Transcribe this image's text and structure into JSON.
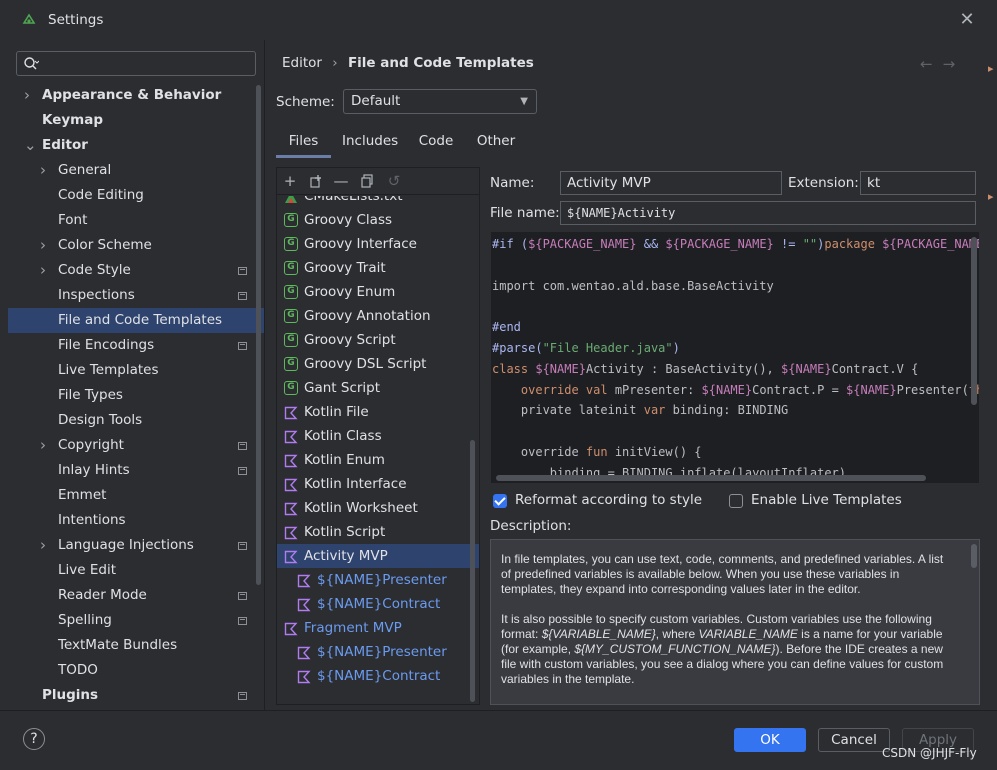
{
  "window": {
    "title": "Settings"
  },
  "search": {
    "value": "",
    "placeholder": ""
  },
  "sidebar": {
    "items": [
      {
        "label": "Appearance & Behavior",
        "bold": true,
        "chevron": "right",
        "level": 0,
        "proj": false
      },
      {
        "label": "Keymap",
        "bold": true,
        "chevron": "",
        "level": 0,
        "proj": false
      },
      {
        "label": "Editor",
        "bold": true,
        "chevron": "down",
        "level": 0,
        "proj": false
      },
      {
        "label": "General",
        "bold": false,
        "chevron": "right",
        "level": 1,
        "proj": false
      },
      {
        "label": "Code Editing",
        "bold": false,
        "chevron": "",
        "level": 1,
        "proj": false
      },
      {
        "label": "Font",
        "bold": false,
        "chevron": "",
        "level": 1,
        "proj": false
      },
      {
        "label": "Color Scheme",
        "bold": false,
        "chevron": "right",
        "level": 1,
        "proj": false
      },
      {
        "label": "Code Style",
        "bold": false,
        "chevron": "right",
        "level": 1,
        "proj": true
      },
      {
        "label": "Inspections",
        "bold": false,
        "chevron": "",
        "level": 1,
        "proj": true
      },
      {
        "label": "File and Code Templates",
        "bold": false,
        "chevron": "",
        "level": 1,
        "proj": false,
        "selected": true
      },
      {
        "label": "File Encodings",
        "bold": false,
        "chevron": "",
        "level": 1,
        "proj": true
      },
      {
        "label": "Live Templates",
        "bold": false,
        "chevron": "",
        "level": 1,
        "proj": false
      },
      {
        "label": "File Types",
        "bold": false,
        "chevron": "",
        "level": 1,
        "proj": false
      },
      {
        "label": "Design Tools",
        "bold": false,
        "chevron": "",
        "level": 1,
        "proj": false
      },
      {
        "label": "Copyright",
        "bold": false,
        "chevron": "right",
        "level": 1,
        "proj": true
      },
      {
        "label": "Inlay Hints",
        "bold": false,
        "chevron": "",
        "level": 1,
        "proj": true
      },
      {
        "label": "Emmet",
        "bold": false,
        "chevron": "",
        "level": 1,
        "proj": false
      },
      {
        "label": "Intentions",
        "bold": false,
        "chevron": "",
        "level": 1,
        "proj": false
      },
      {
        "label": "Language Injections",
        "bold": false,
        "chevron": "right",
        "level": 1,
        "proj": true
      },
      {
        "label": "Live Edit",
        "bold": false,
        "chevron": "",
        "level": 1,
        "proj": false
      },
      {
        "label": "Reader Mode",
        "bold": false,
        "chevron": "",
        "level": 1,
        "proj": true
      },
      {
        "label": "Spelling",
        "bold": false,
        "chevron": "",
        "level": 1,
        "proj": true
      },
      {
        "label": "TextMate Bundles",
        "bold": false,
        "chevron": "",
        "level": 1,
        "proj": false
      },
      {
        "label": "TODO",
        "bold": false,
        "chevron": "",
        "level": 1,
        "proj": false
      },
      {
        "label": "Plugins",
        "bold": true,
        "chevron": "",
        "level": 0,
        "proj": true
      }
    ]
  },
  "breadcrumb": {
    "parent": "Editor",
    "separator": "›",
    "current": "File and Code Templates"
  },
  "scheme": {
    "label": "Scheme:",
    "value": "Default"
  },
  "tabs": [
    "Files",
    "Includes",
    "Code",
    "Other"
  ],
  "templates": [
    {
      "label": "CMakeLists.txt",
      "icon": "cmake-icon",
      "indent": 0
    },
    {
      "label": "Groovy Class",
      "icon": "groovy-icon",
      "indent": 0
    },
    {
      "label": "Groovy Interface",
      "icon": "groovy-icon",
      "indent": 0
    },
    {
      "label": "Groovy Trait",
      "icon": "groovy-icon",
      "indent": 0
    },
    {
      "label": "Groovy Enum",
      "icon": "groovy-icon",
      "indent": 0
    },
    {
      "label": "Groovy Annotation",
      "icon": "groovy-icon",
      "indent": 0
    },
    {
      "label": "Groovy Script",
      "icon": "groovy-icon",
      "indent": 0
    },
    {
      "label": "Groovy DSL Script",
      "icon": "groovy-icon",
      "indent": 0
    },
    {
      "label": "Gant Script",
      "icon": "groovy-icon",
      "indent": 0
    },
    {
      "label": "Kotlin File",
      "icon": "kotlin-icon",
      "indent": 0
    },
    {
      "label": "Kotlin Class",
      "icon": "kotlin-icon",
      "indent": 0
    },
    {
      "label": "Kotlin Enum",
      "icon": "kotlin-icon",
      "indent": 0
    },
    {
      "label": "Kotlin Interface",
      "icon": "kotlin-icon",
      "indent": 0
    },
    {
      "label": "Kotlin Worksheet",
      "icon": "kotlin-icon",
      "indent": 0
    },
    {
      "label": "Kotlin Script",
      "icon": "kotlin-icon",
      "indent": 0
    },
    {
      "label": "Activity MVP",
      "icon": "kotlin-icon",
      "indent": 0,
      "selected": true
    },
    {
      "label": "${NAME}Presenter",
      "icon": "kotlin-icon",
      "indent": 1,
      "blue": true
    },
    {
      "label": "${NAME}Contract",
      "icon": "kotlin-icon",
      "indent": 1,
      "blue": true
    },
    {
      "label": "Fragment MVP",
      "icon": "kotlin-icon",
      "indent": 0,
      "blue": true
    },
    {
      "label": "${NAME}Presenter",
      "icon": "kotlin-icon",
      "indent": 1,
      "blue": true
    },
    {
      "label": "${NAME}Contract",
      "icon": "kotlin-icon",
      "indent": 1,
      "blue": true
    }
  ],
  "form": {
    "name_label": "Name:",
    "name_value": "Activity MVP",
    "extension_label": "Extension:",
    "extension_value": "kt",
    "filename_label": "File name:",
    "filename_value": "${NAME}Activity"
  },
  "code": [
    [
      [
        "dir",
        "#if ("
      ],
      [
        "var",
        "${PACKAGE_NAME}"
      ],
      [
        "dir",
        " && "
      ],
      [
        "var",
        "${PACKAGE_NAME}"
      ],
      [
        "dir",
        " != "
      ],
      [
        "str",
        "\"\""
      ],
      [
        "dir",
        ")"
      ],
      [
        "kw",
        "package "
      ],
      [
        "var",
        "${PACKAGE_NAME}"
      ]
    ],
    [],
    [
      [
        "plain",
        "import com.wentao.ald.base.BaseActivity"
      ]
    ],
    [],
    [
      [
        "dir",
        "#end"
      ]
    ],
    [
      [
        "dir",
        "#parse("
      ],
      [
        "str",
        "\"File Header.java\""
      ],
      [
        "dir",
        ")"
      ]
    ],
    [
      [
        "kw",
        "class "
      ],
      [
        "var",
        "${NAME}"
      ],
      [
        "plain",
        "Activity : BaseActivity(), "
      ],
      [
        "var",
        "${NAME}"
      ],
      [
        "plain",
        "Contract.V {"
      ]
    ],
    [
      [
        "plain",
        "    "
      ],
      [
        "kw",
        "override val "
      ],
      [
        "plain",
        "mPresenter: "
      ],
      [
        "var",
        "${NAME}"
      ],
      [
        "plain",
        "Contract.P = "
      ],
      [
        "var",
        "${NAME}"
      ],
      [
        "plain",
        "Presenter("
      ],
      [
        "kw",
        "this"
      ]
    ],
    [
      [
        "plain",
        "    private lateinit "
      ],
      [
        "kw",
        "var "
      ],
      [
        "plain",
        "binding: BINDING"
      ]
    ],
    [],
    [
      [
        "plain",
        "    override "
      ],
      [
        "kw",
        "fun "
      ],
      [
        "plain",
        "initView() {"
      ]
    ],
    [
      [
        "plain",
        "        binding = BINDING.inflate(layoutInflater)"
      ]
    ]
  ],
  "options": {
    "reformat_label": "Reformat according to style",
    "reformat_checked": true,
    "live_label": "Enable Live Templates",
    "live_checked": false
  },
  "description": {
    "label": "Description:",
    "p1": "In file templates, you can use text, code, comments, and predefined variables. A list of predefined variables is available below. When you use these variables in templates, they expand into corresponding values later in the editor.",
    "p2_a": "It is also possible to specify custom variables. Custom variables use the following format: ",
    "p2_b": "${VARIABLE_NAME}",
    "p2_c": ", where ",
    "p2_d": "VARIABLE_NAME",
    "p2_e": " is a name for your variable (for example, ",
    "p2_f": "${MY_CUSTOM_FUNCTION_NAME}",
    "p2_g": "). Before the IDE creates a new file with custom variables, you see a dialog where you can define values for custom variables in the template."
  },
  "buttons": {
    "ok": "OK",
    "cancel": "Cancel",
    "apply": "Apply",
    "help": "?"
  },
  "watermark": "CSDN @JHJF-Fly",
  "colors": {
    "accent": "#3574f0",
    "selection": "#2e436e",
    "background": "#2b2d30",
    "editor_bg": "#1e1f22"
  }
}
